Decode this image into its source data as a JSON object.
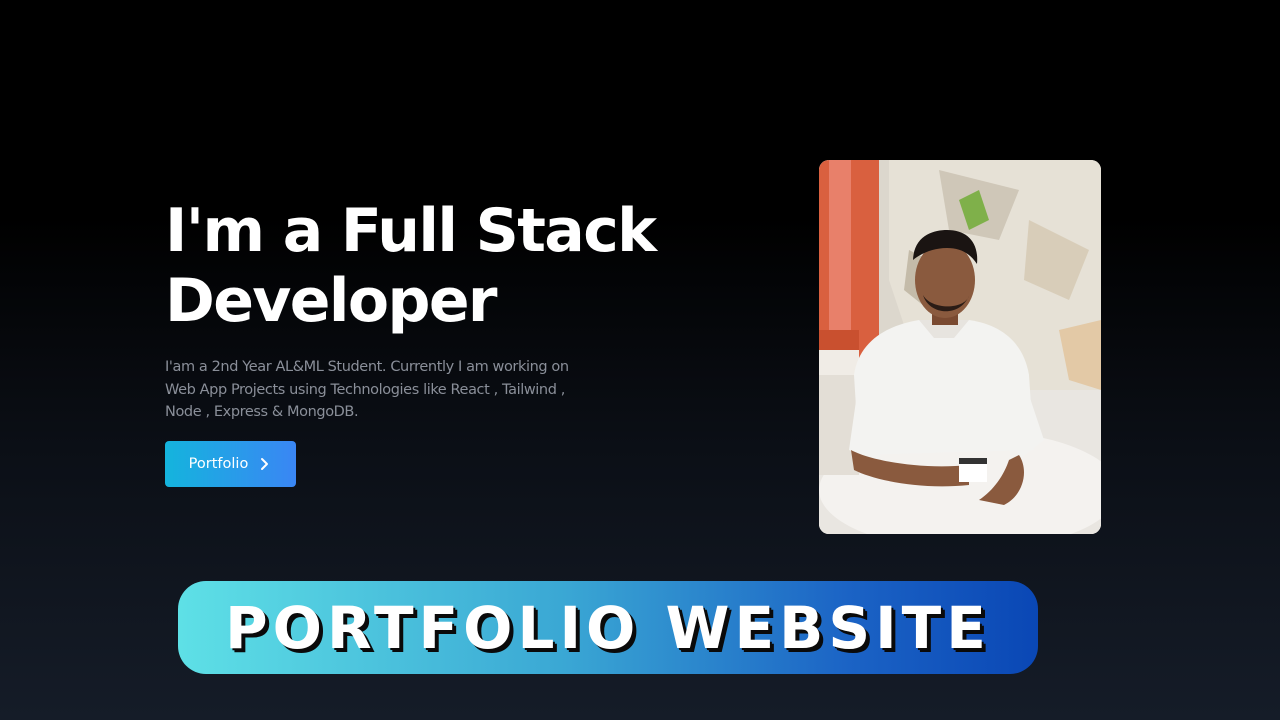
{
  "hero": {
    "headline_line1": "I'm a Full Stack",
    "headline_line2": "Developer",
    "description": "I'am a 2nd Year AL&ML Student. Currently I am working on Web App Projects using Technologies like React , Tailwind , Node , Express & MongoDB.",
    "button_label": "Portfolio",
    "button_icon": "chevron-right-icon"
  },
  "banner": {
    "title": "PORTFOLIO WEBSITE"
  },
  "colors": {
    "background_top": "#000000",
    "background_bottom": "#151c28",
    "button_gradient_start": "#14b4dd",
    "button_gradient_end": "#3a86f4",
    "banner_gradient_start": "#5ee0e6",
    "banner_gradient_end": "#0a47b5",
    "description_text": "#8a8f99"
  }
}
